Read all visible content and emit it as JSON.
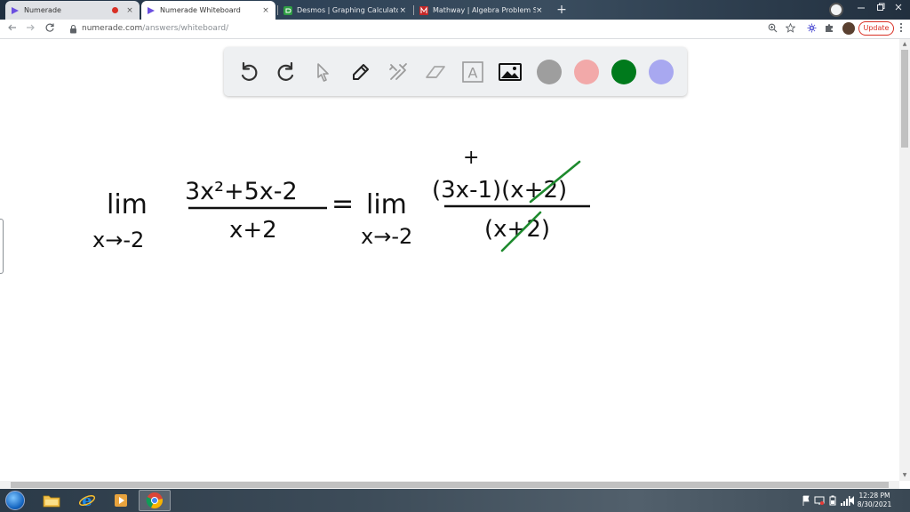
{
  "browser": {
    "tabs": [
      {
        "label": "Numerade",
        "active": false,
        "recording": true
      },
      {
        "label": "Numerade Whiteboard",
        "active": true,
        "recording": false
      },
      {
        "label": "Desmos | Graphing Calculator",
        "active": false,
        "recording": false
      },
      {
        "label": "Mathway | Algebra Problem Solver",
        "active": false,
        "recording": false
      }
    ],
    "close_glyph": "×",
    "new_tab_glyph": "+",
    "url_host": "numerade.com",
    "url_path": "/answers/whiteboard/",
    "update_label": "Update"
  },
  "whiteboard": {
    "tools": [
      "undo-icon",
      "redo-icon",
      "pointer-icon",
      "pen-icon",
      "tools-icon",
      "eraser-icon",
      "text-icon",
      "image-icon"
    ],
    "text_tool_glyph": "A",
    "colors": [
      "#9e9e9e",
      "#f2a9a9",
      "#007a1c",
      "#a8a8f0"
    ],
    "ink_color": "#111111",
    "highlight_ink": "#1e8a2e"
  },
  "math": {
    "lim1": "lim",
    "sub1": "x→-2",
    "num1": "3x²+5x-2",
    "den1": "x+2",
    "equals": "=",
    "lim2": "lim",
    "sub2": "x→-2",
    "num2": "(3x-1)(x+2)",
    "den2": "(x+2)",
    "cursor": "+"
  },
  "taskbar": {
    "apps": [
      "explorer-icon",
      "ie-icon",
      "media-icon",
      "chrome-icon"
    ],
    "time": "12:28 PM",
    "date": "8/30/2021"
  }
}
